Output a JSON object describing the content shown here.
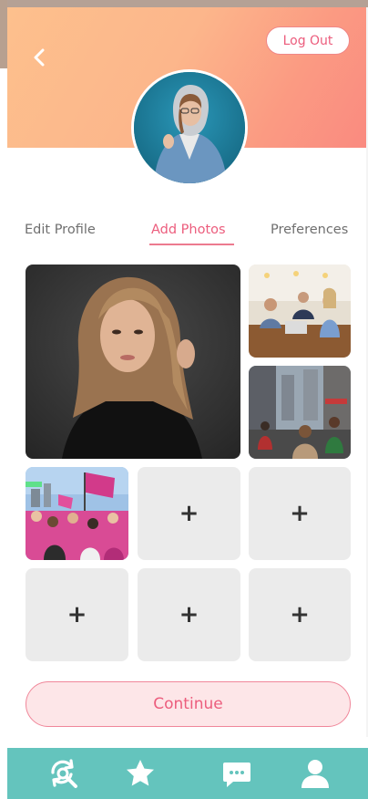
{
  "header": {
    "logout_label": "Log Out",
    "gradient_colors": [
      "#fdc08d",
      "#fb9a82",
      "#fa8a80"
    ]
  },
  "tabs": [
    {
      "label": "Edit Profile",
      "active": false
    },
    {
      "label": "Add Photos",
      "active": true
    },
    {
      "label": "Preferences",
      "active": false
    }
  ],
  "photos": {
    "empty_slot_symbol": "+",
    "filled_count": 4,
    "empty_count": 5
  },
  "footer": {
    "continue_label": "Continue"
  },
  "nav": {
    "items": [
      {
        "icon": "discover-refresh-search-icon"
      },
      {
        "icon": "star-icon"
      },
      {
        "icon": "chat-bubble-icon"
      },
      {
        "icon": "user-profile-icon"
      }
    ],
    "color": "#64c4bd"
  },
  "colors": {
    "accent": "#ec5d7d",
    "tile_empty": "#ebebeb"
  }
}
